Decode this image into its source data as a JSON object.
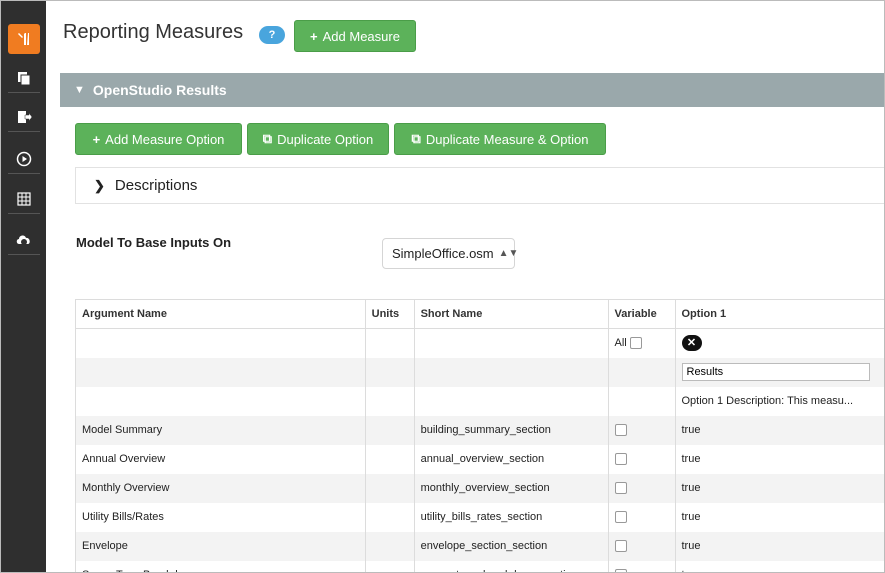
{
  "sidebar": {
    "items": [
      {
        "icon": "tools-icon",
        "active": true
      },
      {
        "icon": "copy-icon"
      },
      {
        "icon": "export-icon"
      },
      {
        "icon": "play-icon"
      },
      {
        "icon": "grid-icon"
      },
      {
        "icon": "cloud-icon"
      }
    ]
  },
  "header": {
    "title": "Reporting Measures",
    "help_label": "?",
    "add_measure_label": "Add Measure"
  },
  "section": {
    "title": "OpenStudio Results",
    "buttons": {
      "add_option": "Add Measure Option",
      "duplicate_option": "Duplicate Option",
      "duplicate_measure_option": "Duplicate Measure & Option"
    },
    "descriptions_label": "Descriptions",
    "model_label": "Model To Base Inputs On",
    "model_value": "SimpleOffice.osm"
  },
  "table": {
    "headers": [
      "Argument Name",
      "Units",
      "Short Name",
      "Variable",
      "Option 1"
    ],
    "all_label": "All",
    "option_name_value": "Results",
    "option_description": "Option 1 Description: This measu...",
    "rows": [
      {
        "name": "Model Summary",
        "units": "",
        "short": "building_summary_section",
        "value": "true"
      },
      {
        "name": "Annual Overview",
        "units": "",
        "short": "annual_overview_section",
        "value": "true"
      },
      {
        "name": "Monthly Overview",
        "units": "",
        "short": "monthly_overview_section",
        "value": "true"
      },
      {
        "name": "Utility Bills/Rates",
        "units": "",
        "short": "utility_bills_rates_section",
        "value": "true"
      },
      {
        "name": "Envelope",
        "units": "",
        "short": "envelope_section_section",
        "value": "true"
      },
      {
        "name": "Space Type Breakdown",
        "units": "",
        "short": "space_type_breakdown_section",
        "value": "true"
      }
    ]
  },
  "colors": {
    "accent_orange": "#f07c21",
    "button_green": "#5cb25a",
    "section_gray": "#9aa8ab",
    "help_blue": "#49a5dd"
  }
}
